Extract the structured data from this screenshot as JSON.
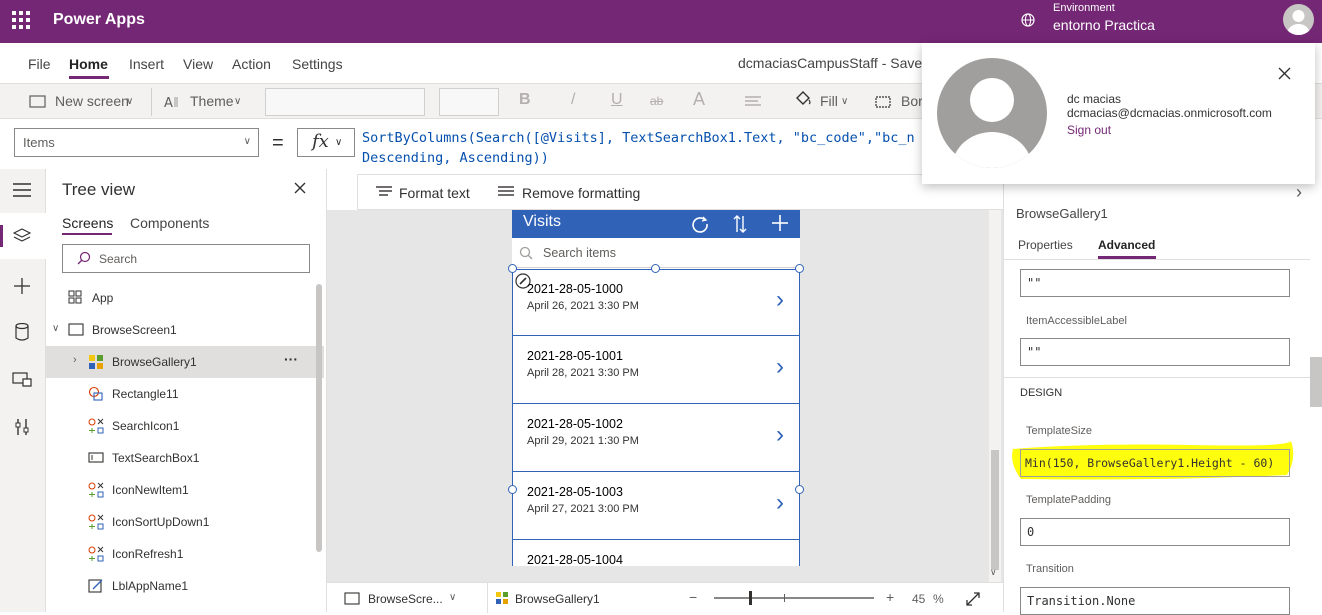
{
  "topbar": {
    "app_title": "Power Apps",
    "env_label": "Environment",
    "env_value": "entorno Practica"
  },
  "menu": {
    "items": [
      "File",
      "Home",
      "Insert",
      "View",
      "Action",
      "Settings"
    ],
    "active": "Home",
    "doc_title": "dcmaciasCampusStaff - Saved"
  },
  "ribbon": {
    "new_screen": "New screen",
    "theme": "Theme",
    "bold": "B",
    "italic": "/",
    "underline": "U",
    "strike": "ab",
    "font_size": "A",
    "fill": "Fill",
    "border": "Bor"
  },
  "formula": {
    "property": "Items",
    "equals": "=",
    "fx": "fx",
    "line1": "SortByColumns(Search([@Visits], TextSearchBox1.Text, \"bc_code\",\"bc_n",
    "line2": "Descending, Ascending))",
    "format_text": "Format text",
    "remove_formatting": "Remove formatting"
  },
  "tree": {
    "title": "Tree view",
    "tabs": [
      "Screens",
      "Components"
    ],
    "active_tab": "Screens",
    "search_placeholder": "Search",
    "items": [
      {
        "label": "App",
        "icon": "app-icon"
      },
      {
        "label": "BrowseScreen1",
        "icon": "screen-icon"
      },
      {
        "label": "BrowseGallery1",
        "icon": "gallery-icon"
      },
      {
        "label": "Rectangle11",
        "icon": "shape-icon"
      },
      {
        "label": "SearchIcon1",
        "icon": "icon-control-icon"
      },
      {
        "label": "TextSearchBox1",
        "icon": "textbox-icon"
      },
      {
        "label": "IconNewItem1",
        "icon": "icon-control-icon"
      },
      {
        "label": "IconSortUpDown1",
        "icon": "icon-control-icon"
      },
      {
        "label": "IconRefresh1",
        "icon": "icon-control-icon"
      },
      {
        "label": "LblAppName1",
        "icon": "label-icon"
      }
    ],
    "more": "···"
  },
  "phone": {
    "title": "Visits",
    "search_placeholder": "Search items",
    "items": [
      {
        "code": "2021-28-05-1000",
        "date": "April 26, 2021 3:30 PM"
      },
      {
        "code": "2021-28-05-1001",
        "date": "April 28, 2021 3:30 PM"
      },
      {
        "code": "2021-28-05-1002",
        "date": "April 29, 2021 1:30 PM"
      },
      {
        "code": "2021-28-05-1003",
        "date": "April 27, 2021 3:00 PM"
      },
      {
        "code": "2021-28-05-1004",
        "date": ""
      }
    ]
  },
  "statusbar": {
    "screen": "BrowseScre...",
    "control": "BrowseGallery1",
    "zoom_value": "45",
    "zoom_unit": "%",
    "minus": "−",
    "plus": "+"
  },
  "properties": {
    "control_name": "BrowseGallery1",
    "tabs": [
      "Properties",
      "Advanced"
    ],
    "active_tab": "Advanced",
    "field_top_value": "\"\"",
    "item_accessible_label": "ItemAccessibleLabel",
    "item_accessible_value": "\"\"",
    "design_header": "DESIGN",
    "template_size_label": "TemplateSize",
    "template_size_value": "Min(150, BrowseGallery1.Height - 60)",
    "template_padding_label": "TemplatePadding",
    "template_padding_value": "0",
    "transition_label": "Transition",
    "transition_value": "Transition.None"
  },
  "account": {
    "name": "dc macias",
    "email": "dcmacias@dcmacias.onmicrosoft.com",
    "sign_out": "Sign out"
  },
  "colors": {
    "brand": "#742774",
    "gallery_header": "#3062b8",
    "highlight": "#ffff00"
  }
}
